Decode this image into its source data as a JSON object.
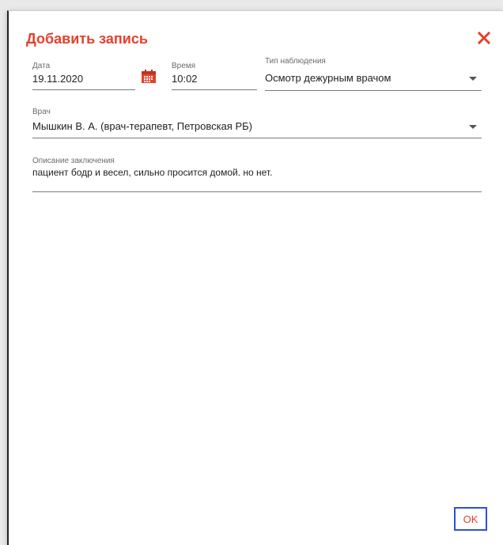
{
  "dialog": {
    "title": "Добавить запись",
    "close_icon": "close-icon",
    "ok_label": "OK"
  },
  "fields": {
    "date": {
      "label": "Дата",
      "value": "19.11.2020",
      "icon": "calendar-icon"
    },
    "time": {
      "label": "Время",
      "value": "10:02"
    },
    "observation_type": {
      "label": "Тип наблюдения",
      "value": "Осмотр дежурным врачом"
    },
    "doctor": {
      "label": "Врач",
      "value": "Мышкин В. А. (врач-терапевт, Петровская РБ)"
    },
    "conclusion": {
      "label": "Описание заключения",
      "value": "пациент бодр и весел, сильно просится домой. но нет."
    }
  },
  "colors": {
    "accent": "#e4412b",
    "focus_border": "#2f4fd9",
    "text": "#222222",
    "label": "#6b6b6b"
  }
}
